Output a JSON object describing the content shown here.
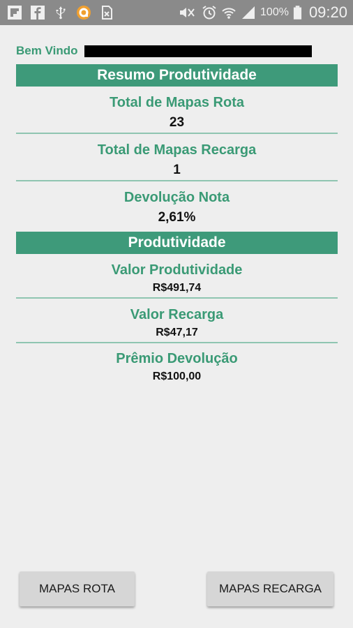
{
  "status_bar": {
    "battery_percent": "100%",
    "time": "09:20",
    "icons_left": [
      "flipboard-icon",
      "facebook-icon",
      "usb-icon",
      "app-notification-icon",
      "sim-card-icon"
    ],
    "icons_right": [
      "mute-icon",
      "alarm-icon",
      "wifi-icon",
      "signal-icon",
      "battery-icon"
    ]
  },
  "welcome": {
    "label": "Bem Vindo"
  },
  "resumo": {
    "title": "Resumo Produtividade",
    "items": [
      {
        "label": "Total de Mapas Rota",
        "value": "23"
      },
      {
        "label": "Total de Mapas Recarga",
        "value": "1"
      },
      {
        "label": "Devolução Nota",
        "value": "2,61%"
      }
    ]
  },
  "produtividade": {
    "title": "Produtividade",
    "items": [
      {
        "label": "Valor Produtividade",
        "value": "R$491,74"
      },
      {
        "label": "Valor Recarga",
        "value": "R$47,17"
      },
      {
        "label": "Prêmio Devolução",
        "value": "R$100,00"
      }
    ]
  },
  "buttons": {
    "mapas_rota": "MAPAS ROTA",
    "mapas_recarga": "MAPAS RECARGA"
  },
  "colors": {
    "accent": "#3e9a7a",
    "label_green": "#3a9a75",
    "status_bar": "#8a8a8a",
    "background": "#eeeeee"
  }
}
